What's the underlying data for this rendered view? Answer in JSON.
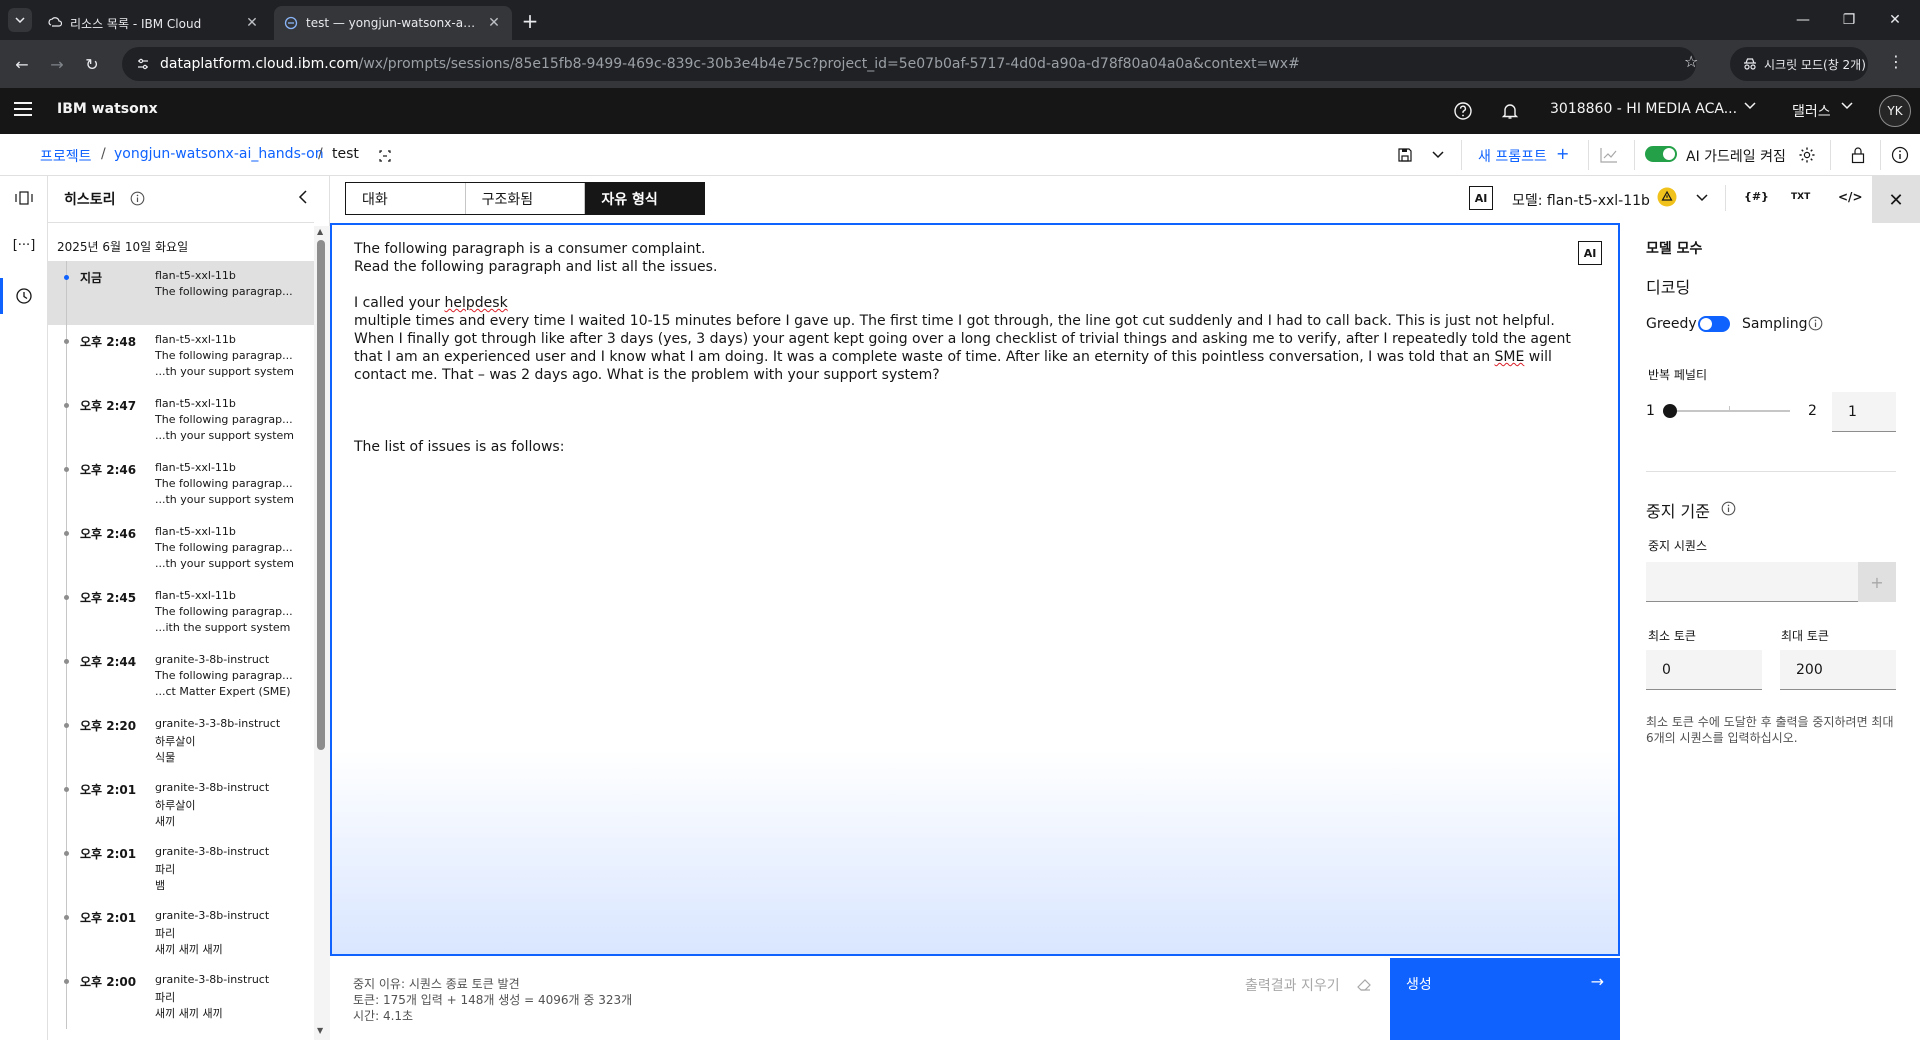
{
  "browser": {
    "tabs": [
      {
        "title": "리소스 목록 - IBM Cloud",
        "active": false
      },
      {
        "title": "test — yongjun-watsonx-ai_ha",
        "active": true
      }
    ],
    "url_host": "dataplatform.cloud.ibm.com",
    "url_path": "/wx/prompts/sessions/85e15fb8-9499-469c-839c-30b3e4b4e75c?project_id=5e07b0af-5717-4d0d-a90a-d78f80a04a0a&context=wx#",
    "incognito_label": "시크릿 모드(창 2개)"
  },
  "header": {
    "brand": "IBM watsonx",
    "account": "3018860 - HI MEDIA ACA...",
    "region": "댈러스",
    "avatar": "YK"
  },
  "breadcrumb": {
    "items": [
      "프로젝트",
      "yongjun-watsonx-ai_hands-on",
      "test"
    ],
    "separator": "/"
  },
  "toolbar": {
    "new_prompt": "새 프롬프트",
    "guardrail_label": "AI 가드레일 켜짐",
    "guardrail_on": true
  },
  "history": {
    "title": "히스토리",
    "date": "2025년 6월 10일 화요일",
    "items": [
      {
        "time": "지금",
        "model": "flan-t5-xxl-11b",
        "line2": "The following paragrap...",
        "line3": ""
      },
      {
        "time": "오후 2:48",
        "model": "flan-t5-xxl-11b",
        "line2": "The following paragrap...",
        "line3": "...th your support system"
      },
      {
        "time": "오후 2:47",
        "model": "flan-t5-xxl-11b",
        "line2": "The following paragrap...",
        "line3": "...th your support system"
      },
      {
        "time": "오후 2:46",
        "model": "flan-t5-xxl-11b",
        "line2": "The following paragrap...",
        "line3": "...th your support system"
      },
      {
        "time": "오후 2:46",
        "model": "flan-t5-xxl-11b",
        "line2": "The following paragrap...",
        "line3": "...th your support system"
      },
      {
        "time": "오후 2:45",
        "model": "flan-t5-xxl-11b",
        "line2": "The following paragrap...",
        "line3": "...ith the support system"
      },
      {
        "time": "오후 2:44",
        "model": "granite-3-8b-instruct",
        "line2": "The following paragrap...",
        "line3": "...ct Matter Expert (SME)"
      },
      {
        "time": "오후 2:20",
        "model": "granite-3-3-8b-instruct",
        "line2": "하루살이",
        "line3": "식물"
      },
      {
        "time": "오후 2:01",
        "model": "granite-3-8b-instruct",
        "line2": "하루살이",
        "line3": "새끼"
      },
      {
        "time": "오후 2:01",
        "model": "granite-3-8b-instruct",
        "line2": "파리",
        "line3": "뱀"
      },
      {
        "time": "오후 2:01",
        "model": "granite-3-8b-instruct",
        "line2": "파리",
        "line3": "새끼 새끼 새끼"
      },
      {
        "time": "오후 2:00",
        "model": "granite-3-8b-instruct",
        "line2": "파리",
        "line3": "새끼 새끼 새끼"
      }
    ]
  },
  "modes": {
    "chat": "대화",
    "structured": "구조화됨",
    "freeform": "자유 형식"
  },
  "model_selector": {
    "ai_badge": "AI",
    "label": "모델: flan-t5-xxl-11b",
    "txt_label": "TXT"
  },
  "editor": {
    "ai_badge": "AI",
    "line1": "The following paragraph is a consumer complaint.",
    "line2": "Read the following paragraph and list all the issues.",
    "line3_pre": "I called your ",
    "line3_word": "helpdesk",
    "para_a": "multiple times and every time I waited 10-15 minutes before I gave up. The first time I got through, the line got cut suddenly and I had to call back. This is just not helpful. When I finally got through like after 3 days (yes, 3 days) your agent kept going over a long checklist of trivial things and asking me to verify, after I repeatedly told the agent that I am an experienced user and I know what I am doing. It was a complete waste of time. After like an eternity of this pointless conversation, I was told that an ",
    "para_sme": "SME",
    "para_b": " will contact me. That – was 2 days ago. What is the problem with your support system?",
    "list_line": "The list of issues is as follows:"
  },
  "footer": {
    "stop_reason": "중지 이유: 시퀀스 종료 토큰 발견",
    "tokens": "토큰: 175개 입력 + 148개 생성 = 4096개 중 323개",
    "time": "시간: 4.1초",
    "clear_output": "출력결과 지우기",
    "generate": "생성"
  },
  "params": {
    "title": "모델 모수",
    "decoding_title": "디코딩",
    "greedy": "Greedy",
    "sampling": "Sampling",
    "decoding_mode": "Greedy",
    "repetition_penalty_label": "반복 페널티",
    "rp_min": "1",
    "rp_max": "2",
    "rp_value": "1",
    "stop_title": "중지 기준",
    "stop_seq_label": "중지 시퀀스",
    "stop_seq_value": "",
    "min_tokens_label": "최소 토큰",
    "min_tokens": "0",
    "max_tokens_label": "최대 토큰",
    "max_tokens": "200",
    "hint": "최소 토큰 수에 도달한 후 출력을 중지하려면 최대 6개의 시퀀스를 입력하십시오."
  },
  "colors": {
    "accent": "#0f62fe",
    "toggle_on": "#24a148",
    "warning": "#f1c21b"
  }
}
